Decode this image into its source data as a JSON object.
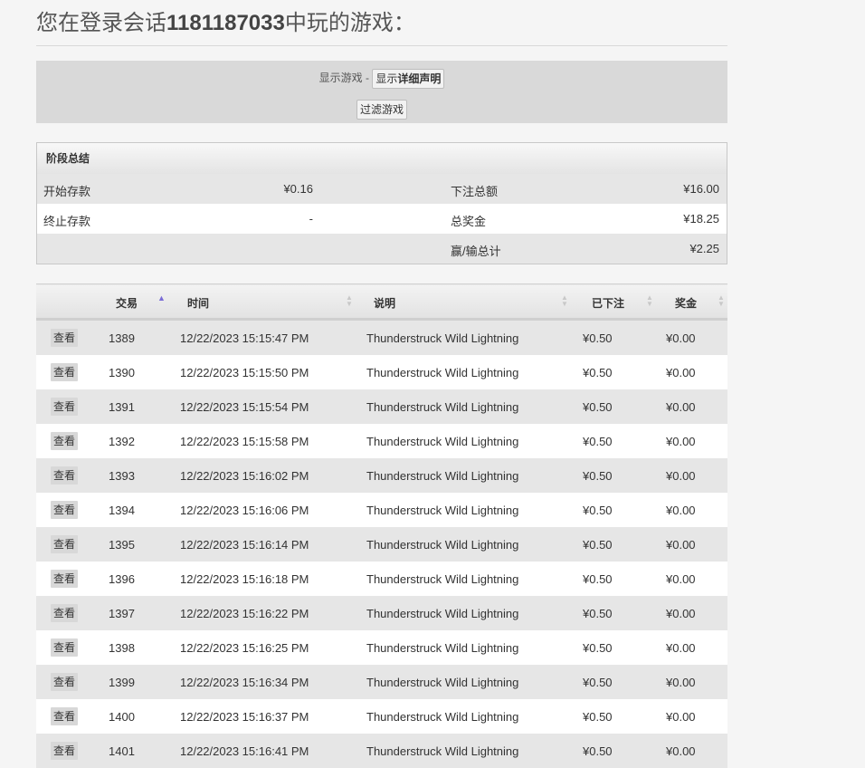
{
  "header": {
    "title_prefix": "您在登录会话",
    "session_id": "1181187033",
    "title_suffix": "中玩的游戏："
  },
  "filters": {
    "show_games_label": "显示游戏 -",
    "show_details_prefix": "显示",
    "show_details_bold": "详细声明",
    "filter_button": "过滤游戏"
  },
  "summary": {
    "title": "阶段总结",
    "rows": [
      {
        "label1": "开始存款",
        "value1": "¥0.16",
        "label2": "下注总额",
        "value2": "¥16.00"
      },
      {
        "label1": "终止存款",
        "value1": "-",
        "label2": "总奖金",
        "value2": "¥18.25"
      },
      {
        "label1": "",
        "value1": "",
        "label2": "赢/输总计",
        "value2": "¥2.25"
      }
    ]
  },
  "table": {
    "columns": [
      "",
      "交易",
      "时间",
      "说明",
      "已下注",
      "奖金"
    ],
    "view_label": "查看",
    "rows": [
      {
        "tx": "1389",
        "time": "12/22/2023 15:15:47 PM",
        "desc": "Thunderstruck Wild Lightning",
        "bet": "¥0.50",
        "win": "¥0.00"
      },
      {
        "tx": "1390",
        "time": "12/22/2023 15:15:50 PM",
        "desc": "Thunderstruck Wild Lightning",
        "bet": "¥0.50",
        "win": "¥0.00"
      },
      {
        "tx": "1391",
        "time": "12/22/2023 15:15:54 PM",
        "desc": "Thunderstruck Wild Lightning",
        "bet": "¥0.50",
        "win": "¥0.00"
      },
      {
        "tx": "1392",
        "time": "12/22/2023 15:15:58 PM",
        "desc": "Thunderstruck Wild Lightning",
        "bet": "¥0.50",
        "win": "¥0.00"
      },
      {
        "tx": "1393",
        "time": "12/22/2023 15:16:02 PM",
        "desc": "Thunderstruck Wild Lightning",
        "bet": "¥0.50",
        "win": "¥0.00"
      },
      {
        "tx": "1394",
        "time": "12/22/2023 15:16:06 PM",
        "desc": "Thunderstruck Wild Lightning",
        "bet": "¥0.50",
        "win": "¥0.00"
      },
      {
        "tx": "1395",
        "time": "12/22/2023 15:16:14 PM",
        "desc": "Thunderstruck Wild Lightning",
        "bet": "¥0.50",
        "win": "¥0.00"
      },
      {
        "tx": "1396",
        "time": "12/22/2023 15:16:18 PM",
        "desc": "Thunderstruck Wild Lightning",
        "bet": "¥0.50",
        "win": "¥0.00"
      },
      {
        "tx": "1397",
        "time": "12/22/2023 15:16:22 PM",
        "desc": "Thunderstruck Wild Lightning",
        "bet": "¥0.50",
        "win": "¥0.00"
      },
      {
        "tx": "1398",
        "time": "12/22/2023 15:16:25 PM",
        "desc": "Thunderstruck Wild Lightning",
        "bet": "¥0.50",
        "win": "¥0.00"
      },
      {
        "tx": "1399",
        "time": "12/22/2023 15:16:34 PM",
        "desc": "Thunderstruck Wild Lightning",
        "bet": "¥0.50",
        "win": "¥0.00"
      },
      {
        "tx": "1400",
        "time": "12/22/2023 15:16:37 PM",
        "desc": "Thunderstruck Wild Lightning",
        "bet": "¥0.50",
        "win": "¥0.00"
      },
      {
        "tx": "1401",
        "time": "12/22/2023 15:16:41 PM",
        "desc": "Thunderstruck Wild Lightning",
        "bet": "¥0.50",
        "win": "¥0.00"
      }
    ]
  },
  "colors": {
    "page_bg": "#f5f5f5",
    "filter_bg": "#d9d9d9",
    "row_alt": "#e6e6e6",
    "sort_active": "#7a6cd6"
  }
}
